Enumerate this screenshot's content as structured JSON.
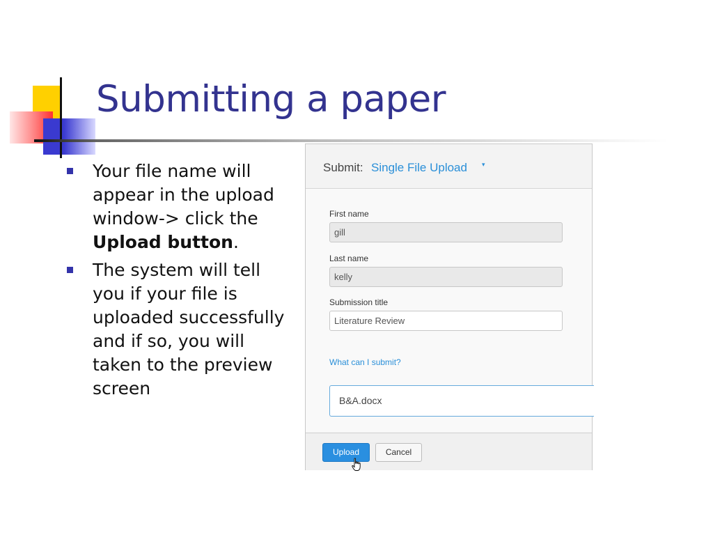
{
  "slide": {
    "title": "Submitting a paper",
    "bullets": [
      {
        "pre": "Your file name will appear in the upload window-> click the ",
        "bold": "Upload button",
        "post": "."
      },
      {
        "pre": "The system will tell you if your file is uploaded successfully and if so, you will taken to the preview screen",
        "bold": "",
        "post": ""
      }
    ]
  },
  "screenshot": {
    "header": {
      "label": "Submit:",
      "mode": "Single File Upload",
      "caret": "▾"
    },
    "fields": {
      "first_name_label": "First name",
      "first_name_value": "gill",
      "last_name_label": "Last name",
      "last_name_value": "kelly",
      "title_label": "Submission title",
      "title_value": "Literature Review"
    },
    "help_link": "What can I submit?",
    "file_name": "B&A.docx",
    "buttons": {
      "upload": "Upload",
      "cancel": "Cancel"
    },
    "colors": {
      "accent": "#2a8fd8",
      "title": "#33338f"
    }
  }
}
